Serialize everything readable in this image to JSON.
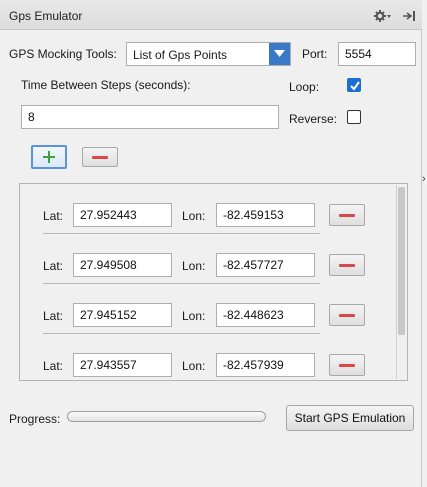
{
  "panel": {
    "title": "Gps Emulator"
  },
  "icons": {
    "settings": "gear-icon",
    "pin": "pin-icon",
    "add": "plus-icon",
    "remove": "minus-icon"
  },
  "tools": {
    "label": "GPS Mocking Tools:",
    "selected": "List of Gps Points",
    "port_label": "Port:",
    "port_value": "5554"
  },
  "timing": {
    "label": "Time Between Steps (seconds):",
    "value": "8",
    "loop_label": "Loop:",
    "loop_checked": true,
    "reverse_label": "Reverse:",
    "reverse_checked": false
  },
  "points": {
    "lat_label": "Lat:",
    "lon_label": "Lon:",
    "rows": [
      {
        "lat": "27.952443",
        "lon": "-82.459153"
      },
      {
        "lat": "27.949508",
        "lon": "-82.457727"
      },
      {
        "lat": "27.945152",
        "lon": "-82.448623"
      },
      {
        "lat": "27.943557",
        "lon": "-82.457939"
      }
    ]
  },
  "footer": {
    "progress_label": "Progress:",
    "progress": 0,
    "start_label": "Start GPS Emulation"
  },
  "colors": {
    "accent": "#3a78c8",
    "remove": "#d9484a",
    "add": "#3aa23a"
  }
}
